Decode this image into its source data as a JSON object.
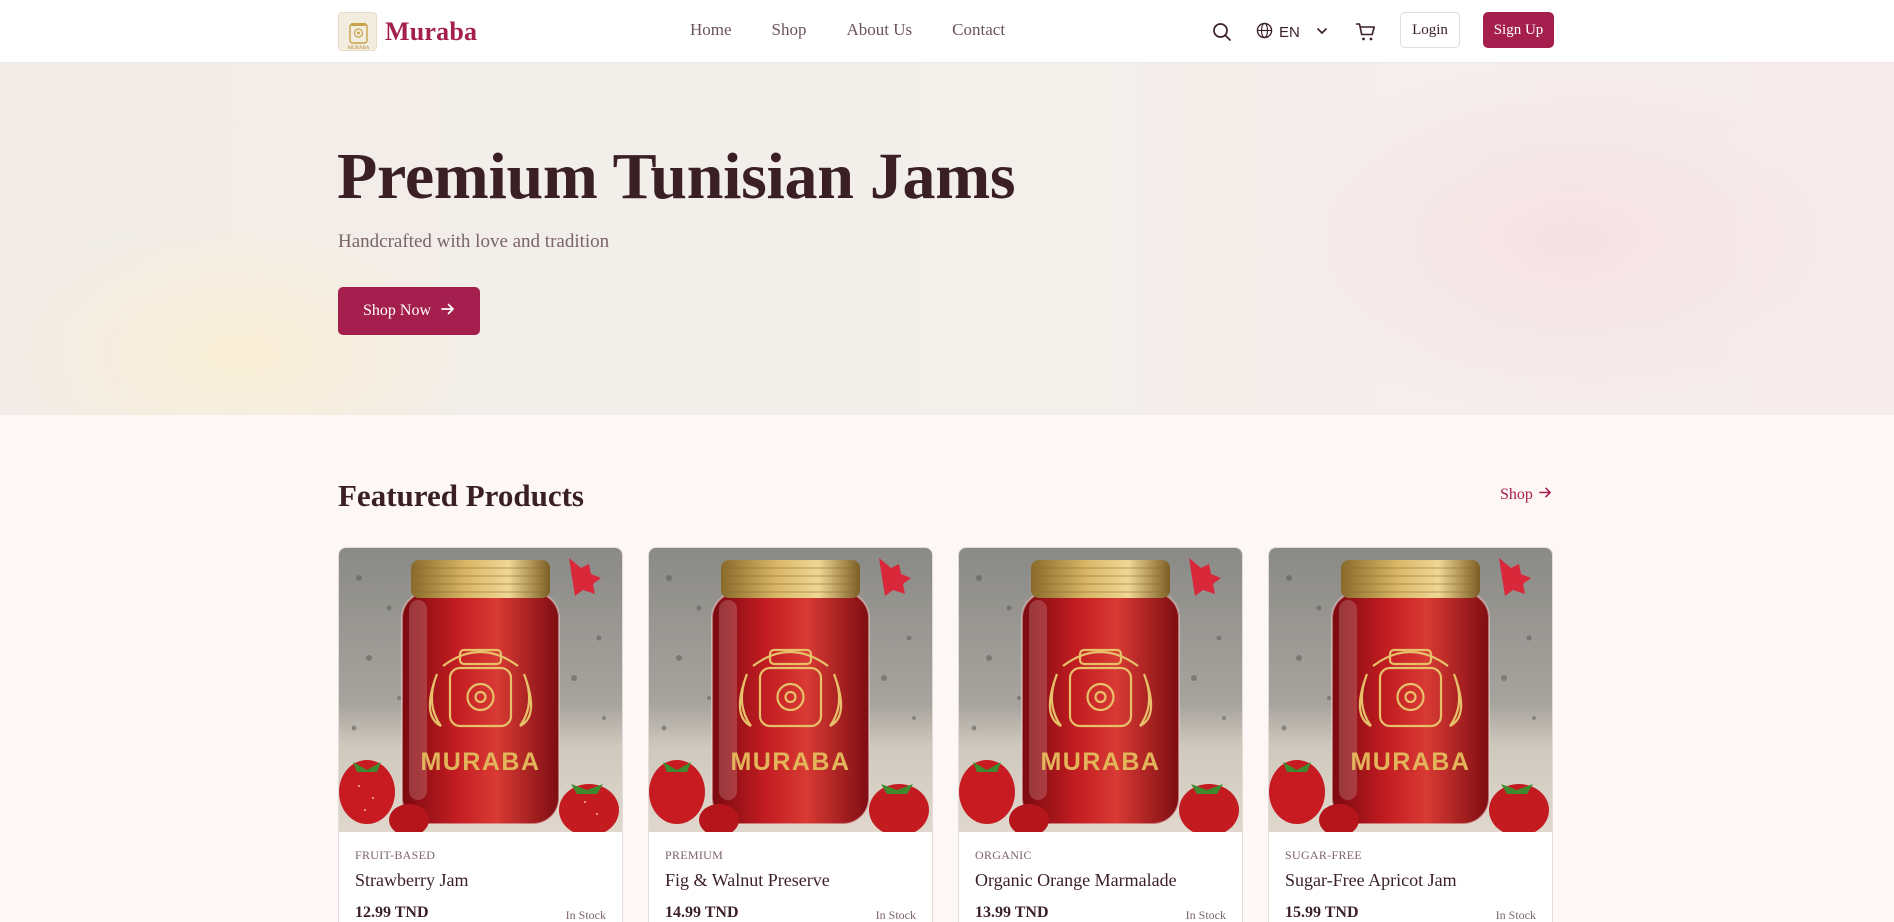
{
  "header": {
    "brand": "Muraba",
    "logo_small_text": "MURABA",
    "nav": [
      {
        "label": "Home"
      },
      {
        "label": "Shop"
      },
      {
        "label": "About Us"
      },
      {
        "label": "Contact"
      }
    ],
    "language": "EN",
    "login_label": "Login",
    "signup_label": "Sign Up",
    "icons": [
      "search-icon",
      "globe-icon",
      "chevron-down-icon",
      "cart-icon"
    ]
  },
  "hero": {
    "title": "Premium Tunisian Jams",
    "subtitle": "Handcrafted with love and tradition",
    "cta_label": "Shop Now"
  },
  "featured": {
    "title": "Featured Products",
    "shop_link": "Shop",
    "products": [
      {
        "category": "FRUIT-BASED",
        "name": "Strawberry Jam",
        "price": "12.99 TND",
        "stock": "In Stock",
        "image_label": "MURABA"
      },
      {
        "category": "PREMIUM",
        "name": "Fig & Walnut Preserve",
        "price": "14.99 TND",
        "stock": "In Stock",
        "image_label": "MURABA"
      },
      {
        "category": "ORGANIC",
        "name": "Organic Orange Marmalade",
        "price": "13.99 TND",
        "stock": "In Stock",
        "image_label": "MURABA"
      },
      {
        "category": "SUGAR-FREE",
        "name": "Sugar-Free Apricot Jam",
        "price": "15.99 TND",
        "stock": "In Stock",
        "image_label": "MURABA"
      }
    ]
  },
  "colors": {
    "brand": "#a41e4e",
    "text": "#3a1f26",
    "muted": "#7a6468",
    "page_bg": "#fdf7f5"
  }
}
